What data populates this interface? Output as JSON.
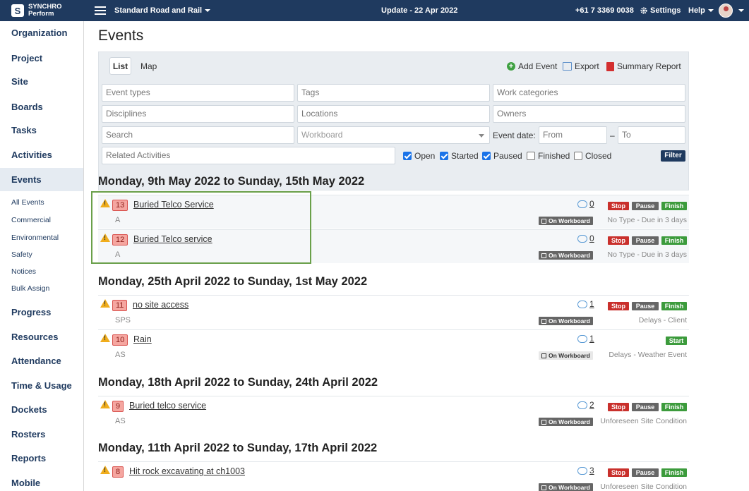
{
  "app": {
    "logo_line1": "SYNCHRO",
    "logo_line2": "Perform",
    "project": "Standard Road and Rail",
    "update": "Update - 22 Apr 2022",
    "phone": "+61 7 3369 0038",
    "settings": "Settings",
    "help": "Help"
  },
  "sidebar": {
    "items": [
      "Organization",
      "Project",
      "Site",
      "Boards",
      "Tasks",
      "Activities",
      "Events",
      "Progress",
      "Resources",
      "Attendance",
      "Time & Usage",
      "Dockets",
      "Rosters",
      "Reports",
      "Mobile"
    ],
    "active": "Events",
    "sub": [
      "All Events",
      "Commercial",
      "Environmental",
      "Safety",
      "Notices",
      "Bulk Assign"
    ]
  },
  "page": {
    "title": "Events"
  },
  "toolbar": {
    "tab_list": "List",
    "tab_map": "Map",
    "add": "Add Event",
    "export": "Export",
    "summary": "Summary Report"
  },
  "filters": {
    "event_types": "Event types",
    "tags": "Tags",
    "work_categories": "Work categories",
    "disciplines": "Disciplines",
    "locations": "Locations",
    "owners": "Owners",
    "search": "Search",
    "workboard": "Workboard",
    "event_date": "Event date:",
    "from": "From",
    "dash": "–",
    "to": "To",
    "related": "Related Activities",
    "open": "Open",
    "started": "Started",
    "paused": "Paused",
    "finished": "Finished",
    "closed": "Closed",
    "filter": "Filter"
  },
  "labels": {
    "stop": "Stop",
    "pause": "Pause",
    "finish": "Finish",
    "start": "Start",
    "on_workboard": "On Workboard"
  },
  "weeks": [
    {
      "heading": "Monday, 9th May 2022 to Sunday, 15th May 2022",
      "events": [
        {
          "num": "13",
          "title": "Buried Telco Service",
          "sub": "A",
          "comments": "0",
          "type": "No Type - Due in 3 days"
        },
        {
          "num": "12",
          "title": "Buried Telco service",
          "sub": "A",
          "comments": "0",
          "type": "No Type - Due in 3 days"
        }
      ]
    },
    {
      "heading": "Monday, 25th April 2022 to Sunday, 1st May 2022",
      "events": [
        {
          "num": "11",
          "title": "no site access",
          "sub": "SPS",
          "comments": "1",
          "type": "Delays - Client"
        },
        {
          "num": "10",
          "title": "Rain",
          "sub": "AS",
          "comments": "1",
          "type": "Delays - Weather Event"
        }
      ]
    },
    {
      "heading": "Monday, 18th April 2022 to Sunday, 24th April 2022",
      "events": [
        {
          "num": "9",
          "title": "Buried telco service",
          "sub": "AS",
          "comments": "2",
          "type": "Unforeseen Site Condition"
        }
      ]
    },
    {
      "heading": "Monday, 11th April 2022 to Sunday, 17th April 2022",
      "events": [
        {
          "num": "8",
          "title": "Hit rock excavating at ch1003",
          "sub": "",
          "comments": "3",
          "type": "Unforeseen Site Condition"
        }
      ]
    }
  ]
}
